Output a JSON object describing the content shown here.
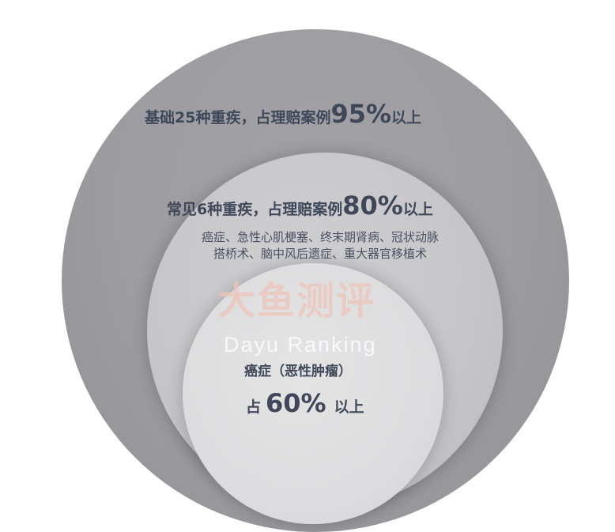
{
  "outer": {
    "prefix": "基础25种重疾，占理赔案例",
    "percent": "95%",
    "suffix": "以上"
  },
  "middle": {
    "prefix": "常见6种重疾，占理赔案例",
    "percent": "80%",
    "suffix": "以上",
    "diseases_line1": "癌症、急性心肌梗塞、终末期肾病、冠状动脉",
    "diseases_line2": "搭桥术、脑中风后遗症、重大器官移植术"
  },
  "inner": {
    "title": "癌症（恶性肿瘤）",
    "prefix": "占",
    "percent": "60%",
    "suffix": "以上"
  },
  "watermark": {
    "cn": "大鱼测评",
    "en": "Dayu Ranking"
  }
}
